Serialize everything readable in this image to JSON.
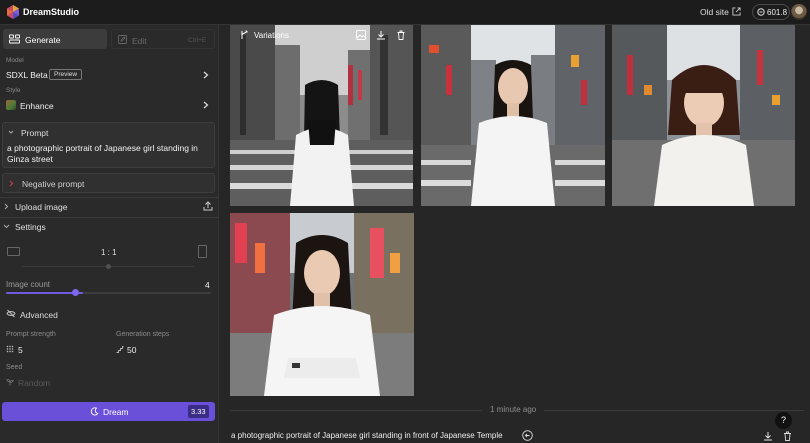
{
  "header": {
    "brand": "DreamStudio",
    "old_site": "Old site",
    "credits": "601.8"
  },
  "sidebar": {
    "tabs": {
      "generate": "Generate",
      "edit": "Edit",
      "edit_shortcut": "Ctrl+E"
    },
    "model": {
      "label": "Model",
      "value": "SDXL Beta",
      "badge": "Preview"
    },
    "style": {
      "label": "Style",
      "value": "Enhance"
    },
    "prompt": {
      "header": "Prompt",
      "text": "a photographic portrait of Japanese girl standing in Ginza street"
    },
    "negative_prompt": {
      "label": "Negative prompt"
    },
    "upload_image": {
      "label": "Upload image"
    },
    "settings": {
      "label": "Settings",
      "aspect_ratio": "1 : 1",
      "image_count": {
        "label": "Image count",
        "value": "4",
        "fraction": 0.375
      },
      "advanced": {
        "label": "Advanced"
      },
      "prompt_strength": {
        "label": "Prompt strength",
        "value": "5"
      },
      "generation_steps": {
        "label": "Generation steps",
        "value": "50"
      },
      "seed": {
        "label": "Seed",
        "value": "Random"
      }
    },
    "dream": {
      "label": "Dream",
      "cost": "3.33"
    }
  },
  "gallery": {
    "variations_label": "Variations",
    "time_label": "1 minute ago",
    "caption": "a photographic portrait of Japanese girl standing in front of Japanese Temple",
    "help": "?"
  },
  "colors": {
    "accent": "#6a4fd8",
    "background": "#262626",
    "sidebar": "#2a2a2a",
    "header": "#1c1c1c"
  }
}
